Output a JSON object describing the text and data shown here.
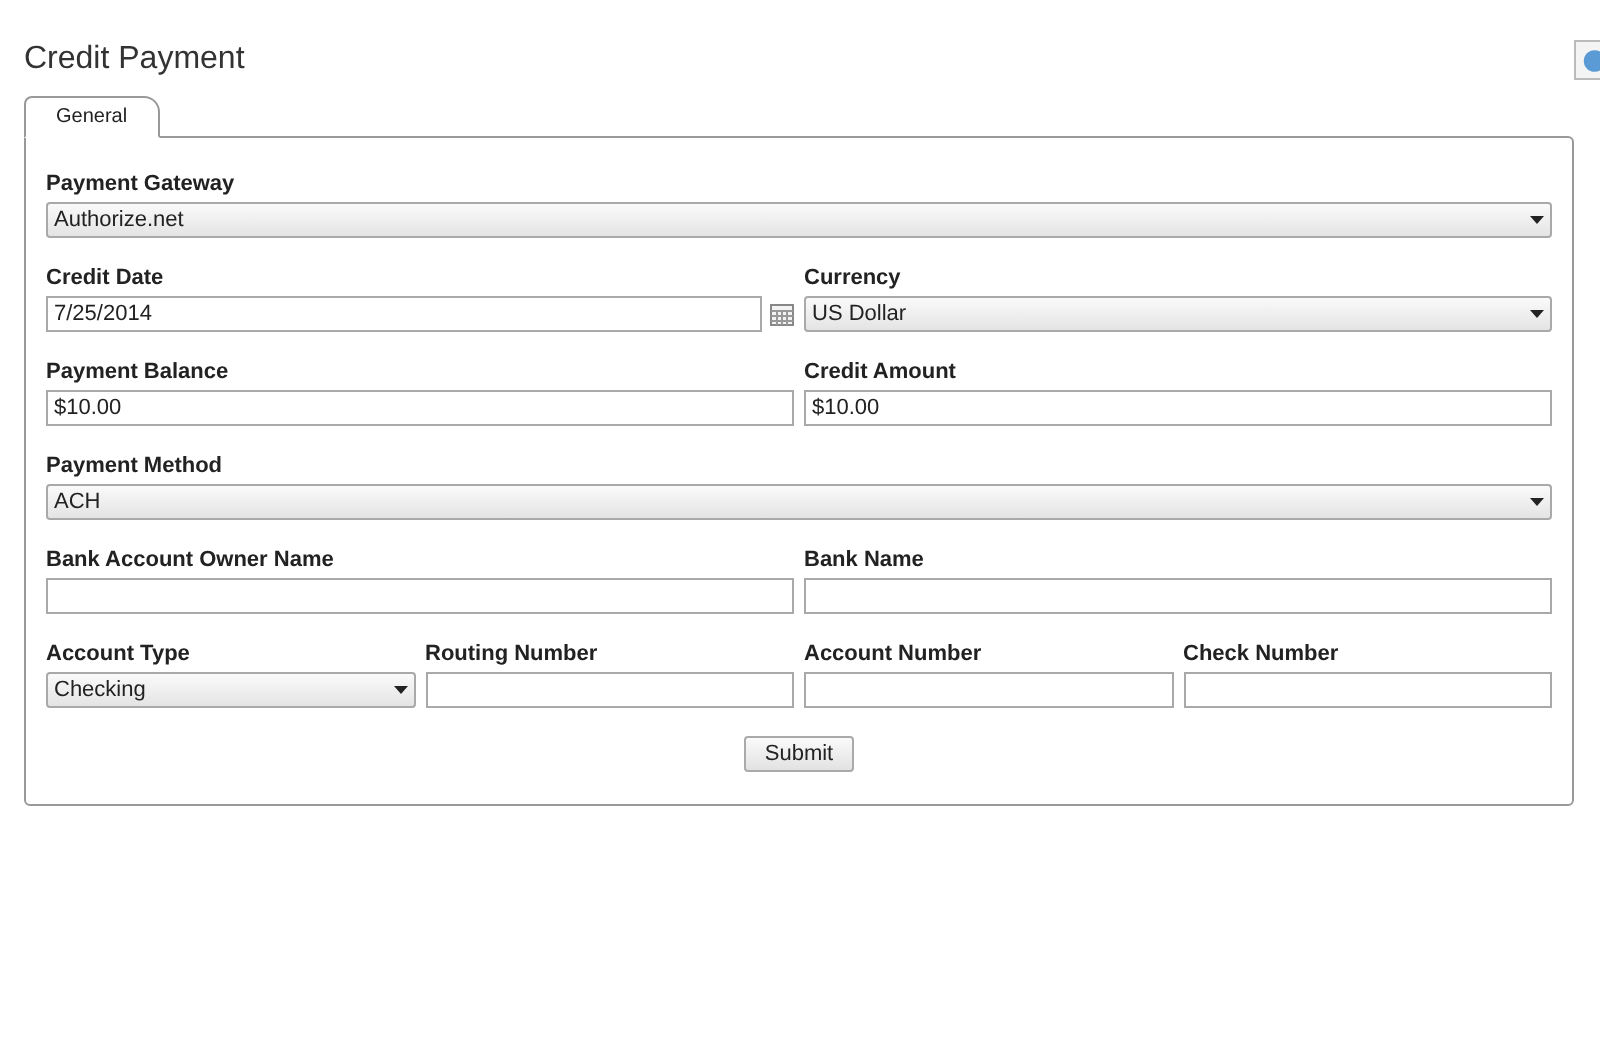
{
  "title": "Credit Payment",
  "tabs": [
    {
      "label": "General",
      "selected": true
    }
  ],
  "rows": [
    [
      {
        "kind": "select",
        "label": "Payment Gateway",
        "value": "Authorize.net"
      }
    ],
    [
      {
        "kind": "date",
        "label": "Credit Date",
        "value": "7/25/2014"
      },
      {
        "kind": "select",
        "label": "Currency",
        "value": "US Dollar"
      }
    ],
    [
      {
        "kind": "text",
        "label": "Payment Balance",
        "value": "$10.00"
      },
      {
        "kind": "text",
        "label": "Credit Amount",
        "value": "$10.00"
      }
    ],
    [
      {
        "kind": "select",
        "label": "Payment Method",
        "value": "ACH"
      }
    ],
    [
      {
        "kind": "text",
        "label": "Bank Account Owner Name"
      },
      {
        "kind": "text",
        "label": "Bank Name"
      }
    ],
    [
      {
        "kind": "select",
        "label": "Account Type",
        "value": "Checking"
      },
      {
        "kind": "text",
        "label": "Routing Number"
      },
      {
        "kind": "text",
        "label": "Account Number"
      },
      {
        "kind": "text",
        "label": "Check Number"
      }
    ]
  ],
  "submit": "Submit"
}
